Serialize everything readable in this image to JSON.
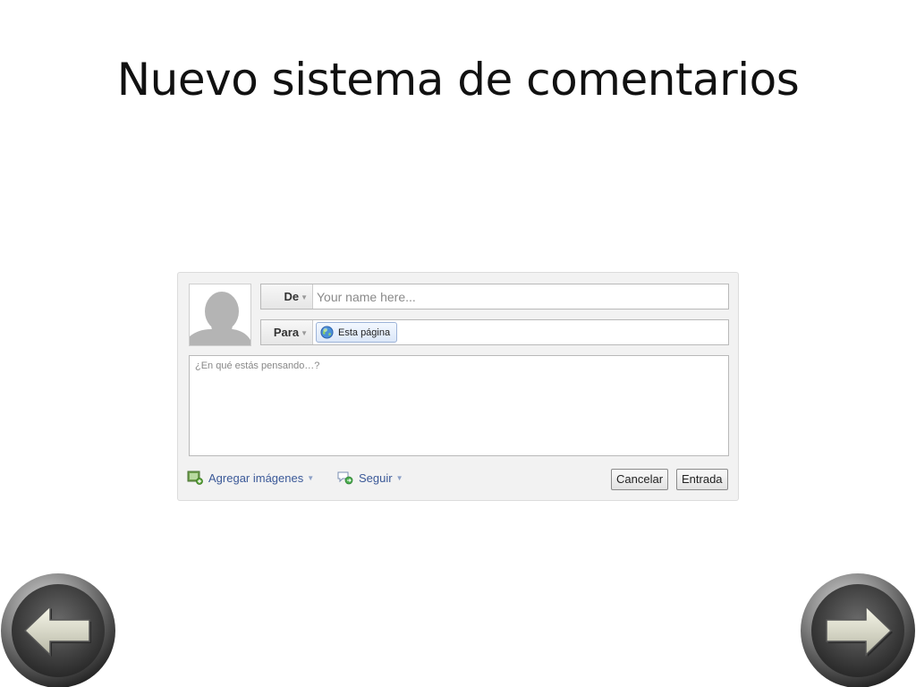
{
  "slide": {
    "title": "Nuevo sistema de comentarios"
  },
  "comment_box": {
    "from_label": "De",
    "name_placeholder": "Your name here...",
    "to_label": "Para",
    "audience": "Esta página",
    "comment_placeholder": "¿En qué estás pensando…?",
    "add_images_label": "Agregar imágenes",
    "follow_label": "Seguir",
    "cancel_label": "Cancelar",
    "submit_label": "Entrada"
  },
  "icons": {
    "avatar": "default-avatar",
    "audience": "globe-icon",
    "add_images": "photo-add-icon",
    "follow": "follow-comment-icon",
    "prev": "left-arrow-icon",
    "next": "right-arrow-icon"
  },
  "colors": {
    "link": "#3b5998",
    "panel_bg": "#f2f2f2",
    "token_border": "#9db3d8"
  }
}
